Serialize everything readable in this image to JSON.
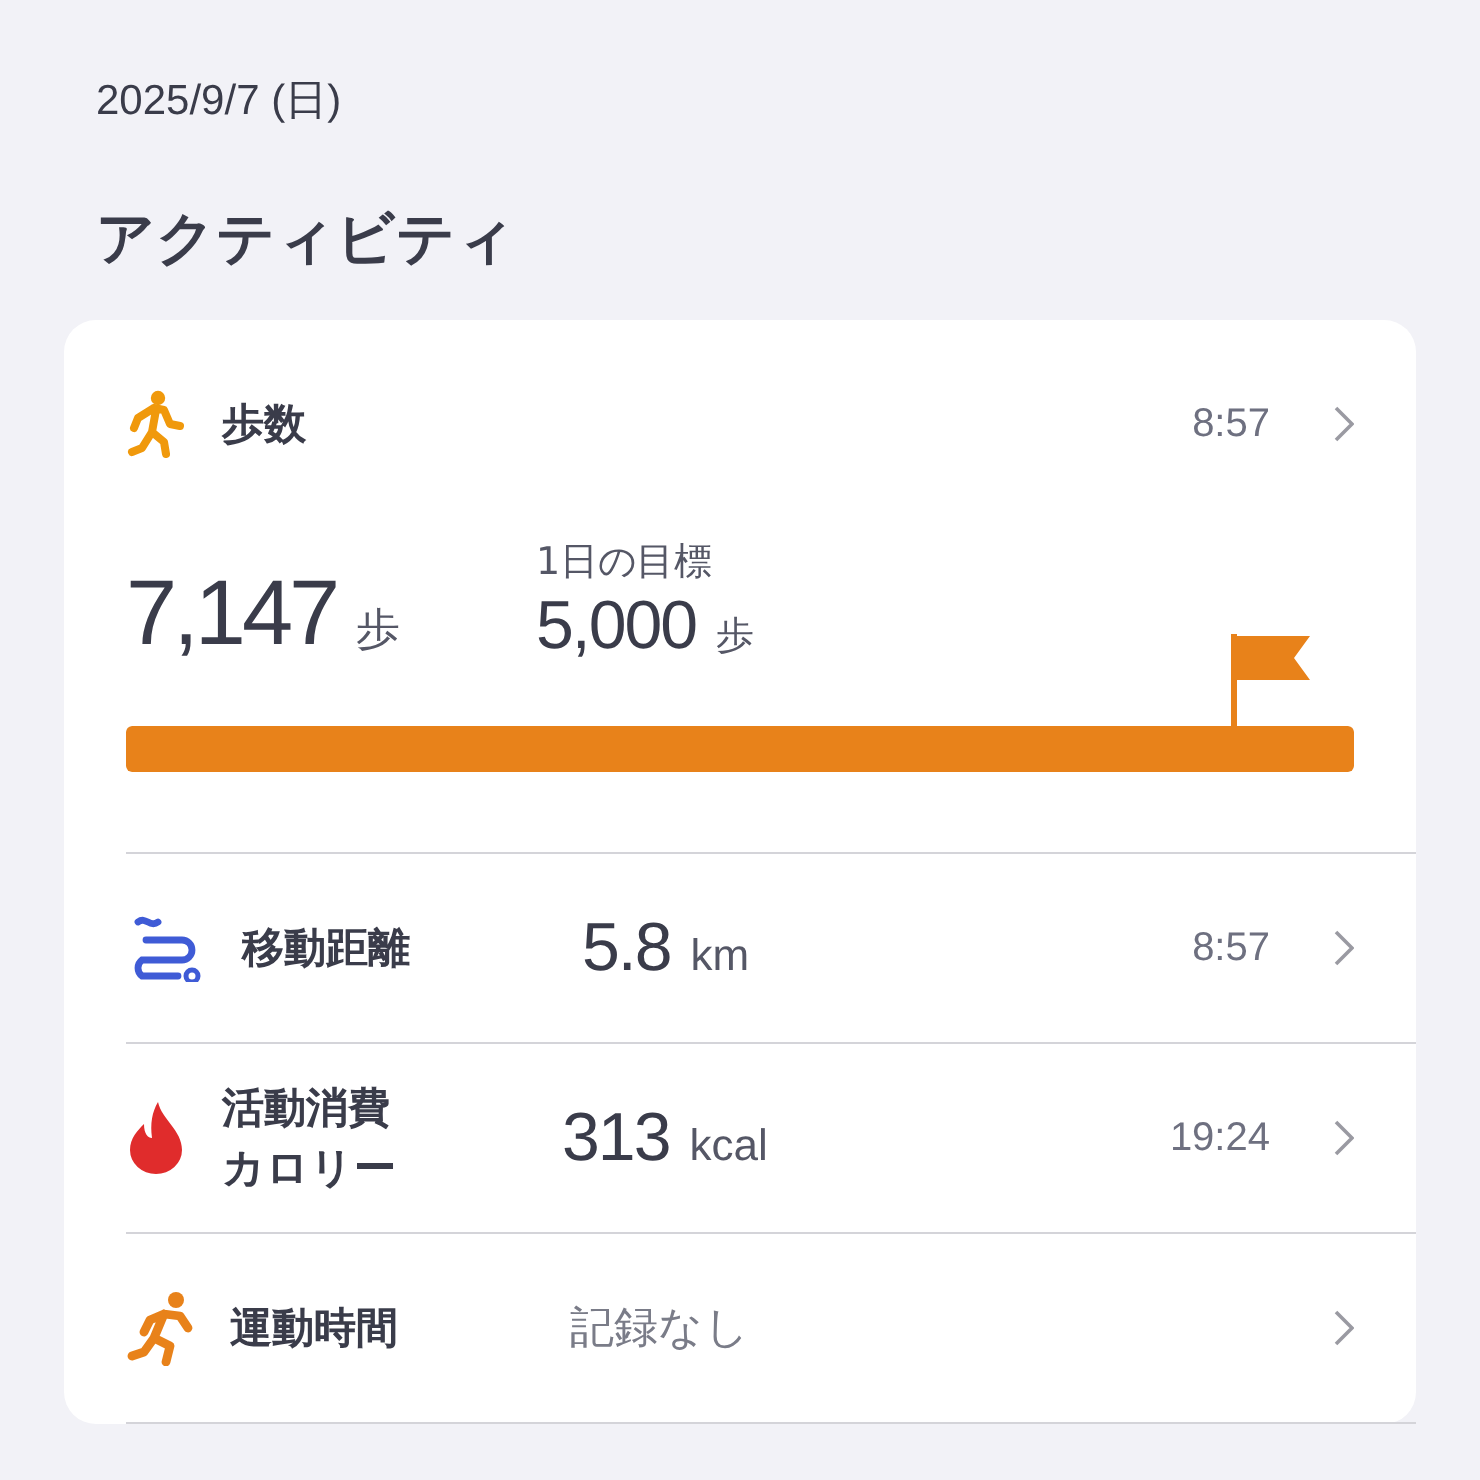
{
  "header": {
    "date": "2025/9/7 (日)"
  },
  "section_title": "アクティビティ",
  "steps": {
    "label": "歩数",
    "time": "8:57",
    "count": "7,147",
    "unit": "歩",
    "goal_label": "1日の目標",
    "goal": "5,000",
    "goal_unit": "歩",
    "level": 1
  },
  "rows": [
    {
      "kind": "distance",
      "label": "移動距離",
      "value": "5.8",
      "unit": "km",
      "time": "8:57"
    },
    {
      "kind": "calories",
      "label": "活動消費カロリー",
      "value": "313",
      "unit": "kcal",
      "time": "19:24"
    },
    {
      "kind": "exercise",
      "label": "運動時間",
      "note": "記録なし"
    }
  ]
}
